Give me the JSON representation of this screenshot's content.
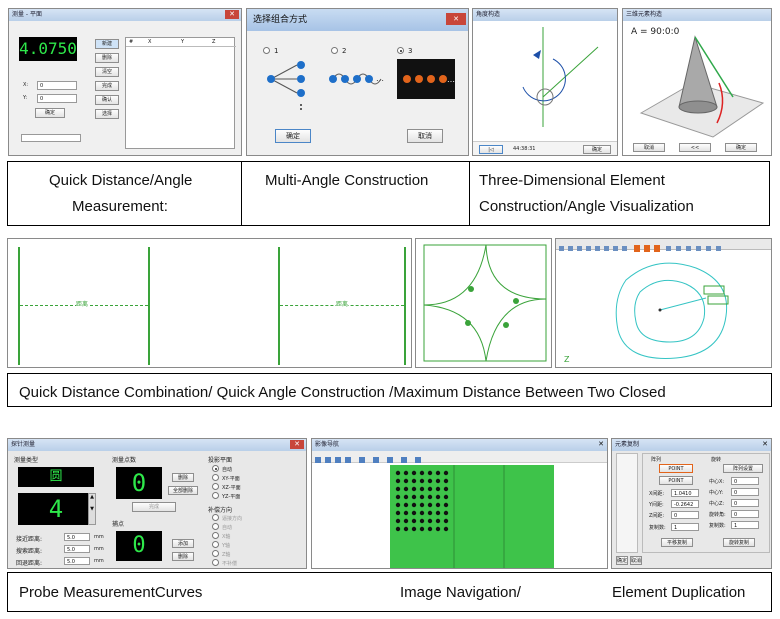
{
  "section1": {
    "shot1": {
      "title": "测量 - 平面",
      "readout": "4.0750",
      "buttons": [
        "新建",
        "删除",
        "清空",
        "完成",
        "确认",
        "选择",
        "确定"
      ],
      "table_headers": [
        "#",
        "X",
        "Y",
        "Z"
      ],
      "x_label": "X:",
      "x_value": "0",
      "y_label": "Y:",
      "y_value": "0"
    },
    "shot2": {
      "title": "选择组合方式",
      "options": [
        "1",
        "2",
        "3"
      ],
      "confirm": "确定",
      "cancel": "取消"
    },
    "shot3": {
      "title": "角度构造",
      "status_time": "44:38:31",
      "confirm": "确定"
    },
    "shot4": {
      "title": "三维元素构造",
      "angle_readout": "A = 90:0:0",
      "buttons": [
        "取消",
        "<<",
        "确定"
      ]
    },
    "captions": {
      "left_line1": "Quick Distance/Angle",
      "left_line2": "Measurement:",
      "middle": "Multi-Angle Construction",
      "right_line1": "Three-Dimensional Element",
      "right_line2": "Construction/Angle Visualization"
    }
  },
  "section2": {
    "caption": "Quick Distance Combination/ Quick Angle Construction /Maximum Distance Between Two Closed",
    "dim_labels": [
      "距离",
      "距离"
    ]
  },
  "section3": {
    "probe": {
      "title": "探针测量",
      "measure_type_label": "测量类型",
      "shape_value": "圆",
      "points_value": "4",
      "measure_points_label": "测量点数",
      "measure_points_value": "0",
      "delete_label": "删除",
      "delete_all_label": "全部删除",
      "finish_label": "完成",
      "capture_label": "捕点",
      "capture_value": "0",
      "add_label": "添加",
      "remove_label": "删除",
      "projection_label": "投影平面",
      "projection_options": [
        "自动",
        "XY-平面",
        "XZ-平面",
        "YZ-平面"
      ],
      "compensation_label": "补偿方向",
      "compensation_options": [
        "逼接方向",
        "自动",
        "X轴",
        "Y轴",
        "Z轴",
        "不补偿"
      ],
      "fields": [
        {
          "label": "接近距离:",
          "value": "5.0",
          "unit": "mm"
        },
        {
          "label": "搜索距离:",
          "value": "5.0",
          "unit": "mm"
        },
        {
          "label": "回退距离:",
          "value": "5.0",
          "unit": "mm"
        }
      ]
    },
    "nav": {
      "title": "影像导航"
    },
    "dup": {
      "title": "元素复制",
      "section_label": "阵列",
      "rotate_label": "旋转",
      "btn_a": "POINT",
      "btn_b": "POINT",
      "btn_c": "阵列设置",
      "rows": [
        {
          "label": "X间距:",
          "value": "1.0410"
        },
        {
          "label": "Y间距:",
          "value": "-0.2642"
        },
        {
          "label": "Z间距:",
          "value": "0"
        },
        {
          "label": "复制数:",
          "value": "1"
        }
      ],
      "rrows": [
        {
          "label": "中心X:",
          "value": "0"
        },
        {
          "label": "中心Y:",
          "value": "0"
        },
        {
          "label": "中心Z:",
          "value": "0"
        },
        {
          "label": "旋转角:",
          "value": "0"
        },
        {
          "label": "复制数:",
          "value": "1"
        }
      ],
      "ok": "确定",
      "cancel": "取消",
      "apply_left": "平移复制",
      "apply_right": "旋转复制"
    },
    "captions": {
      "left": "Probe MeasurementCurves",
      "middle": "Image Navigation/",
      "right": "Element Duplication"
    }
  },
  "colors": {
    "lcd_green": "#2ee84a",
    "cad_green": "#3aa33a",
    "cyan_curve": "#35c4c4",
    "nav_green": "#3ec34a"
  }
}
